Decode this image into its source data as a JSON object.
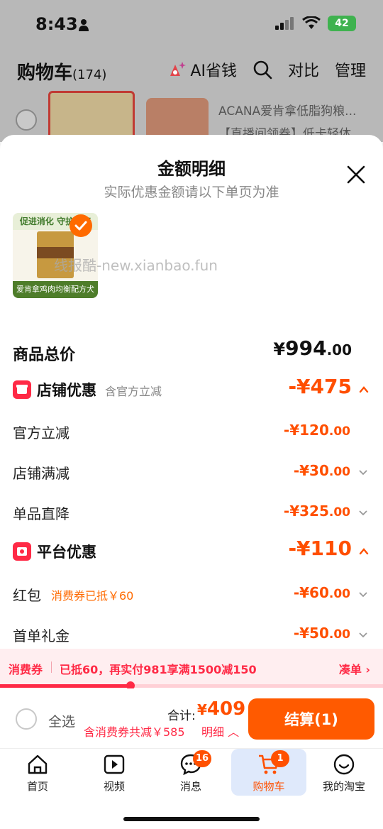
{
  "status_bar": {
    "time": "8:43",
    "battery": "42"
  },
  "cart_header": {
    "title": "购物车",
    "count": "(174)",
    "ai_label": "AI省钱",
    "compare_label": "对比",
    "manage_label": "管理"
  },
  "bg_product": {
    "title1": "ACANA爱肯拿低脂狗粮...",
    "title2": "【直播间领券】低卡轻体..."
  },
  "sheet": {
    "title": "金额明细",
    "subtitle": "实际优惠金额请以下单页为准",
    "thumb_top": "促进消化 守护健康",
    "thumb_bottom": "爱肯拿鸡肉均衡配方犬粮",
    "watermark": "线报酷-new.xianbao.fun"
  },
  "breakdown": {
    "total_label": "商品总价",
    "total_yen": "¥",
    "total_int": "994",
    "total_dec": ".00",
    "shop": {
      "label": "店铺优惠",
      "note": "含官方立减",
      "amount": "-¥475",
      "items": [
        {
          "label": "官方立减",
          "int": "-¥120",
          "dec": ".00"
        },
        {
          "label": "店铺满减",
          "int": "-¥30",
          "dec": ".00"
        },
        {
          "label": "单品直降",
          "int": "-¥325",
          "dec": ".00"
        }
      ]
    },
    "platform": {
      "label": "平台优惠",
      "amount": "-¥110",
      "items": [
        {
          "label": "红包",
          "note": "消费券已抵￥60",
          "int": "-¥60",
          "dec": ".00"
        },
        {
          "label": "首单礼金",
          "int": "-¥50",
          "dec": ".00"
        }
      ]
    }
  },
  "voucher_bar": {
    "tag": "消费券",
    "text": "已抵60，再实付981享满1500减150",
    "link": "凑单",
    "progress": 0.34
  },
  "checkout": {
    "select_all": "全选",
    "sum_label": "合计:",
    "sum_yen": "¥",
    "sum_value": "409",
    "sum_note": "含消费券共减￥585",
    "detail": "明细",
    "button": "结算(1)"
  },
  "tabs": [
    {
      "label": "首页"
    },
    {
      "label": "视频"
    },
    {
      "label": "消息",
      "badge": "16"
    },
    {
      "label": "购物车",
      "badge": "1"
    },
    {
      "label": "我的淘宝"
    }
  ],
  "colors": {
    "accent": "#ff5000",
    "red": "#ff2a46",
    "active_tab_bg": "#dfe9fb"
  }
}
